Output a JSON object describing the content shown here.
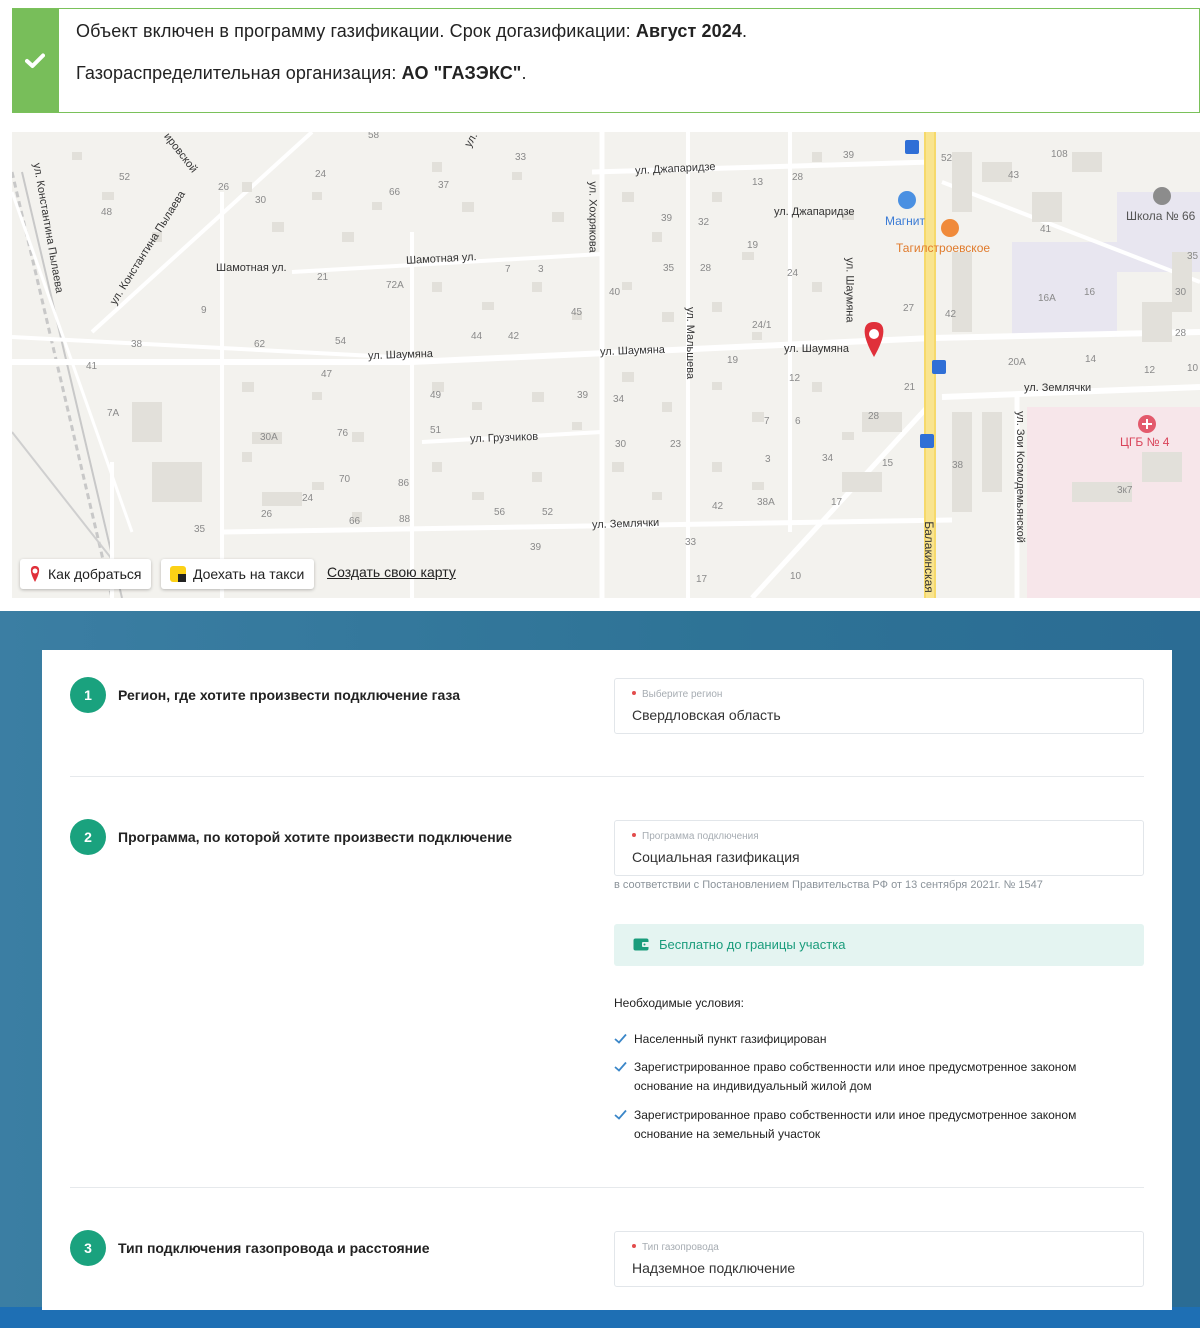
{
  "notice": {
    "line1_prefix": "Объект включен в программу газификации. Срок догазификации: ",
    "line1_bold": "Август 2024",
    "line1_suffix": ".",
    "line2_prefix": "Газораспределительная организация: ",
    "line2_bold": "АО \"ГАЗЭКС\"",
    "line2_suffix": ".",
    "accent_color": "#78be5a"
  },
  "map": {
    "streets": {
      "konstantina": "ул. Константина Пылаева",
      "konstantina2": "ул. Константина Пылаева",
      "dzhaparidze1": "ул. Джапаридзе",
      "dzhaparidze2": "ул. Джапаридзе",
      "shamotnaya1": "Шамотная ул.",
      "shamotnaya2": "Шамотная ул.",
      "shaumyana1": "ул. Шаумяна",
      "shaumyana2": "ул. Шаумяна",
      "shaumyana3": "ул. Шаумяна",
      "shaumyana_v": "ул. Шаумяна",
      "khokhryakova": "ул. Хохрякова",
      "maltsheva": "ул. Мальшева",
      "gruzchikov": "ул. Грузчиков",
      "zemlyachki1": "ул. Землячки",
      "zemlyachki2": "ул. Землячки",
      "zoi": "ул. Зои Космодемьянской",
      "balakinskaya": "Балакинская",
      "kirovskoy": "ировской",
      "ul_top": "ул."
    },
    "pois": {
      "magnit": "Магнит",
      "tagilstroevskoe": "Тагилстроевское",
      "school": "Школа № 66",
      "hospital": "ЦГБ № 4"
    },
    "house_numbers": [
      "58",
      "33",
      "52",
      "26",
      "24",
      "30",
      "66",
      "37",
      "48",
      "21",
      "72А",
      "7",
      "3",
      "9",
      "45",
      "38",
      "62",
      "54",
      "44",
      "42",
      "41",
      "47",
      "49",
      "39",
      "7А",
      "30А",
      "76",
      "51",
      "70",
      "86",
      "24",
      "26",
      "35",
      "66",
      "88",
      "56",
      "52",
      "39",
      "13",
      "28",
      "39",
      "32",
      "19",
      "24",
      "35",
      "28",
      "40",
      "24/1",
      "19",
      "12",
      "34",
      "30",
      "23",
      "7",
      "6",
      "3",
      "42",
      "38А",
      "17",
      "33",
      "17",
      "10",
      "39",
      "52",
      "43",
      "108",
      "41",
      "27",
      "42",
      "16А",
      "16",
      "35",
      "30",
      "28",
      "20А",
      "14",
      "12",
      "10",
      "21",
      "28",
      "38",
      "15",
      "34",
      "3к7"
    ],
    "buttons": {
      "route": "Как добраться",
      "taxi": "Доехать на такси",
      "create": "Создать свою карту"
    }
  },
  "form": {
    "step1": {
      "number": "1",
      "title": "Регион, где хотите произвести подключение газа",
      "field_label": "Выберите регион",
      "field_value": "Свердловская область"
    },
    "step2": {
      "number": "2",
      "title": "Программа, по которой хотите произвести подключение",
      "field_label": "Программа подключения",
      "field_value": "Социальная газификация",
      "note": "в соответствии с Постановлением Правительства РФ от 13 сентября 2021г. № 1547",
      "free_label": "Бесплатно до границы участка",
      "conditions_title": "Необходимые условия:",
      "conditions": [
        "Населенный пункт газифицирован",
        "Зарегистрированное право собственности или иное предусмотренное законом основание на индивидуальный жилой дом",
        "Зарегистрированное право собственности или иное предусмотренное законом основание на земельный участок"
      ]
    },
    "step3": {
      "number": "3",
      "title": "Тип подключения газопровода и расстояние",
      "field_label": "Тип газопровода",
      "field_value": "Надземное подключение"
    }
  },
  "colors": {
    "step_badge": "#1aa27e",
    "background_blue": "#2e7396",
    "free_box_bg": "#e4f4f1",
    "required_dot": "#e24c4c",
    "map_pin": "#e0303a"
  }
}
